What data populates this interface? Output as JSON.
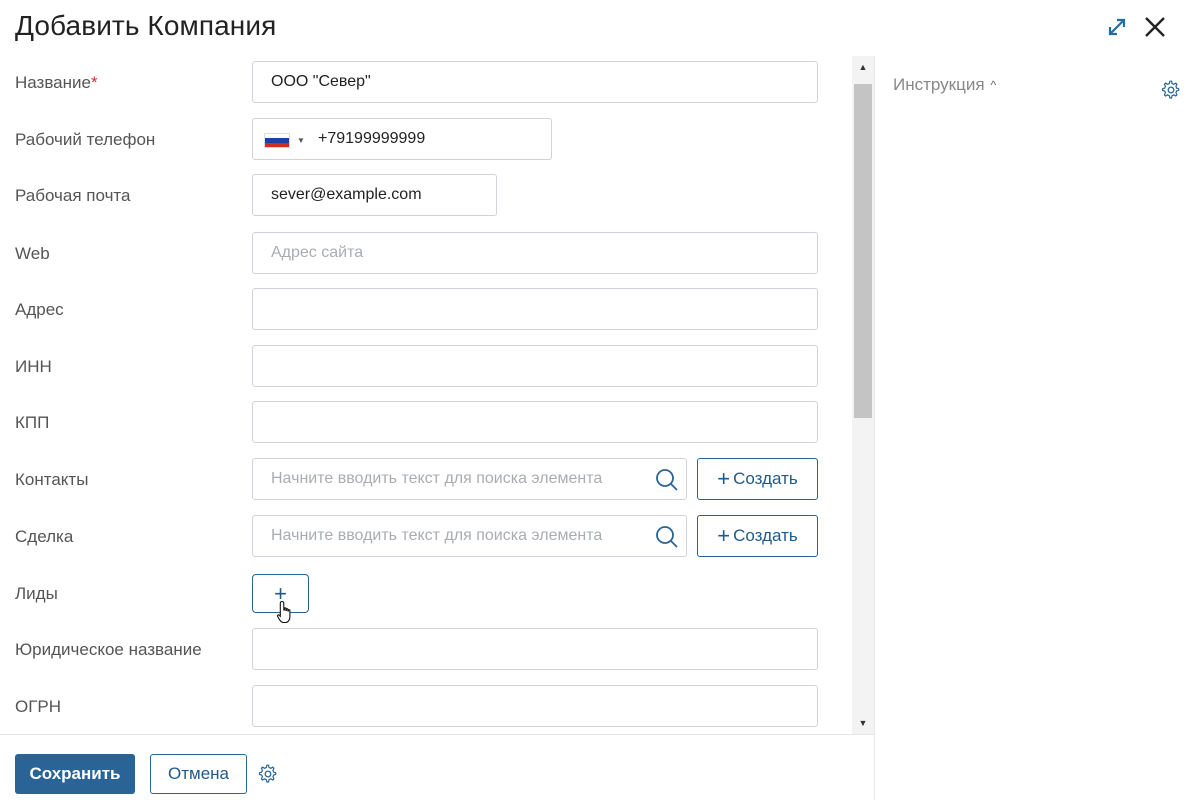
{
  "header": {
    "title": "Добавить Компания",
    "expand_icon": "expand-icon",
    "close_icon": "close-icon"
  },
  "colors": {
    "accent": "#2a6496",
    "required": "#d0302a",
    "border": "#cfd4da"
  },
  "form": {
    "name": {
      "label": "Название",
      "required_mark": "*",
      "value": "ООО \"Север\""
    },
    "phone": {
      "label": "Рабочий телефон",
      "country_flag": "russia-flag-icon",
      "value": "+79199999999"
    },
    "email": {
      "label": "Рабочая почта",
      "value": "sever@example.com"
    },
    "web": {
      "label": "Web",
      "value": "",
      "placeholder": "Адрес сайта"
    },
    "address": {
      "label": "Адрес",
      "value": ""
    },
    "inn": {
      "label": "ИНН",
      "value": ""
    },
    "kpp": {
      "label": "КПП",
      "value": ""
    },
    "contacts": {
      "label": "Контакты",
      "placeholder": "Начните вводить текст для поиска элемента",
      "create_label": "Создать"
    },
    "deal": {
      "label": "Сделка",
      "placeholder": "Начните вводить текст для поиска элемента",
      "create_label": "Создать"
    },
    "leads": {
      "label": "Лиды",
      "add_symbol": "+"
    },
    "legal_name": {
      "label": "Юридическое название",
      "value": ""
    },
    "ogrn": {
      "label": "ОГРН",
      "value": ""
    }
  },
  "footer": {
    "save_label": "Сохранить",
    "cancel_label": "Отмена",
    "settings_icon": "gear-icon"
  },
  "sidebar": {
    "instruction_label": "Инструкция",
    "instruction_caret": "^",
    "settings_icon": "gear-icon"
  }
}
